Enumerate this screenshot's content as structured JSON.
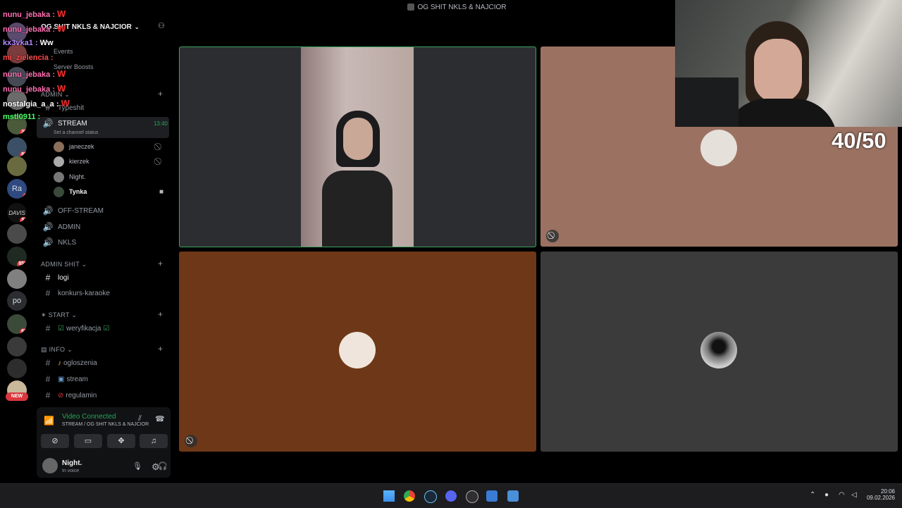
{
  "window": {
    "title": "OG SHIT NKLS & NAJCIOR"
  },
  "server": {
    "name": "OG SHIT NKLS & NAJCIOR",
    "menu": [
      "Events",
      "Server Boosts"
    ]
  },
  "rail_badges": [
    "39",
    "82",
    "1",
    "56",
    "859",
    "62",
    "NEW"
  ],
  "rail_text": {
    "davis": "DAVIS",
    "po": "po",
    "ra": "Ra"
  },
  "chat_overlay": [
    {
      "user": "nunu_jebaka",
      "sep": ":",
      "msg": "W"
    },
    {
      "user": "nunu_jebaka",
      "sep": ":",
      "msg": "W"
    },
    {
      "user": "kx3vka1",
      "sep": ":",
      "msg": "Ww"
    },
    {
      "user": "mi_zielencia",
      "sep": ":",
      "msg": ""
    },
    {
      "user": "nunu_jebaka",
      "sep": ":",
      "msg": "W"
    },
    {
      "user": "nunu_jebaka",
      "sep": ":",
      "msg": "W"
    },
    {
      "user": "nostalgia_a_a",
      "sep": ":",
      "msg": "W"
    },
    {
      "user": "mstl0911",
      "sep": ":",
      "msg": ""
    }
  ],
  "categories": {
    "admin": "ADMIN",
    "admin_shit": "ADMIN SHIT",
    "start": "START",
    "info": "INFO"
  },
  "channels": {
    "typeshit": "Typeshit",
    "stream": "STREAM",
    "stream_time": "13:40",
    "stream_status": "Set a channel status",
    "off_stream": "OFF-STREAM",
    "admin": "ADMIN",
    "nkls": "NKLS",
    "logi": "logi",
    "konkurs": "konkurs-karaoke",
    "weryfikacja": "weryfikacja",
    "ogloszenia": "ogloszenia",
    "stream_text": "stream",
    "regulamin": "regulamin"
  },
  "voice_users": [
    "janeczek",
    "kierzek",
    "Night.",
    "Tynka"
  ],
  "voice_panel": {
    "status": "Video Connected",
    "location": "STREAM / OG SHIT NKLS & NAJCIOR"
  },
  "user_panel": {
    "name": "Night.",
    "status": "In voice"
  },
  "webcam_counter": "40/50",
  "taskbar": {
    "time": "20:06",
    "date": "09.02.2026"
  },
  "colors": {
    "tile_brown_light": "#9b7262",
    "tile_brown_dark": "#6e3818",
    "tile_gray": "#3b3b3b",
    "tile_video_bg": "#2b2d31",
    "accent_green": "#3ba55d",
    "badge_red": "#da373c"
  }
}
